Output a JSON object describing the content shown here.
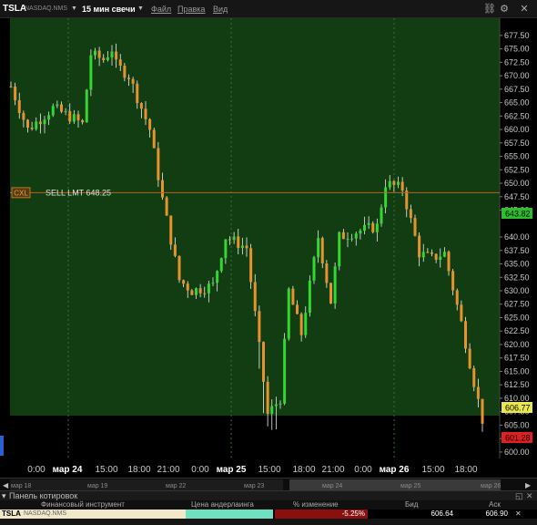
{
  "toolbar": {
    "symbol": "TSLA",
    "exchange": "NASDAQ.NMS",
    "period": "15 мин свечи",
    "menu_file": "Файл",
    "menu_edit": "Правка",
    "menu_view": "Вид"
  },
  "order": {
    "cancel_label": "CXL",
    "order_label": "SELL LMT 648.25",
    "price": 648.25
  },
  "price_tags": {
    "last": "643.82",
    "bid": "606.77",
    "ask": "601.28"
  },
  "axis": {
    "price_ticks": [
      "677.50",
      "675.00",
      "672.50",
      "670.00",
      "667.50",
      "665.00",
      "662.50",
      "660.00",
      "657.50",
      "655.00",
      "652.50",
      "650.00",
      "647.50",
      "645.00",
      "640.00",
      "637.50",
      "635.00",
      "632.50",
      "630.00",
      "627.50",
      "625.00",
      "622.50",
      "620.00",
      "617.50",
      "615.00",
      "612.50",
      "610.00",
      "607.50",
      "605.00",
      "602.50",
      "600.00"
    ],
    "time_labels": [
      "0:00",
      "мар 24",
      "15:00",
      "18:00",
      "21:00",
      "0:00",
      "мар 25",
      "15:00",
      "18:00",
      "21:00",
      "0:00",
      "мар 26",
      "15:00",
      "18:00"
    ],
    "nav_labels": [
      "мар 18",
      "мар 19",
      "мар 22",
      "мар 23",
      "мар 24",
      "мар 25",
      "мар 26"
    ]
  },
  "quote_panel": {
    "title": "Панель котировок",
    "columns": [
      "Финансовый инструмент",
      "Цена андерлаинга",
      "% изменение",
      "Бид",
      "Аск"
    ],
    "row": {
      "symbol": "TSLA",
      "exchange": "NASDAQ.NMS",
      "underlying": "",
      "change": "-5.25%",
      "bid": "606.64",
      "ask": "606.90"
    }
  },
  "colors": {
    "chart_bg": "#123d12",
    "up": "#33d633",
    "down": "#e8922e",
    "order_line": "#b5651d",
    "last_tag": "#2bbf2b",
    "bid_tag": "#e8e84a",
    "ask_tag": "#e02020"
  },
  "chart_data": {
    "type": "candlestick",
    "ylim": [
      598.8,
      680.7
    ],
    "close_path": [
      {
        "t": 0,
        "p": 668
      },
      {
        "t": 4,
        "p": 660
      },
      {
        "t": 10,
        "p": 664
      },
      {
        "t": 15,
        "p": 662
      },
      {
        "t": 17,
        "p": 661
      },
      {
        "t": 19,
        "p": 674
      },
      {
        "t": 22,
        "p": 673
      },
      {
        "t": 24,
        "p": 675
      },
      {
        "t": 25,
        "p": 672
      },
      {
        "t": 28,
        "p": 670
      },
      {
        "t": 31,
        "p": 664
      },
      {
        "t": 33,
        "p": 660
      },
      {
        "t": 36,
        "p": 647
      },
      {
        "t": 40,
        "p": 632
      },
      {
        "t": 43,
        "p": 630
      },
      {
        "t": 48,
        "p": 631
      },
      {
        "t": 51,
        "p": 640
      },
      {
        "t": 56,
        "p": 638
      },
      {
        "t": 61,
        "p": 607
      },
      {
        "t": 64,
        "p": 610
      },
      {
        "t": 66,
        "p": 630
      },
      {
        "t": 69,
        "p": 622
      },
      {
        "t": 73,
        "p": 640
      },
      {
        "t": 76,
        "p": 628
      },
      {
        "t": 78,
        "p": 640
      },
      {
        "t": 82,
        "p": 641
      },
      {
        "t": 87,
        "p": 642
      },
      {
        "t": 89,
        "p": 650
      },
      {
        "t": 93,
        "p": 649
      },
      {
        "t": 97,
        "p": 637
      },
      {
        "t": 100,
        "p": 636
      },
      {
        "t": 103,
        "p": 637
      },
      {
        "t": 107,
        "p": 624
      },
      {
        "t": 110,
        "p": 613
      },
      {
        "t": 112,
        "p": 606
      }
    ]
  }
}
